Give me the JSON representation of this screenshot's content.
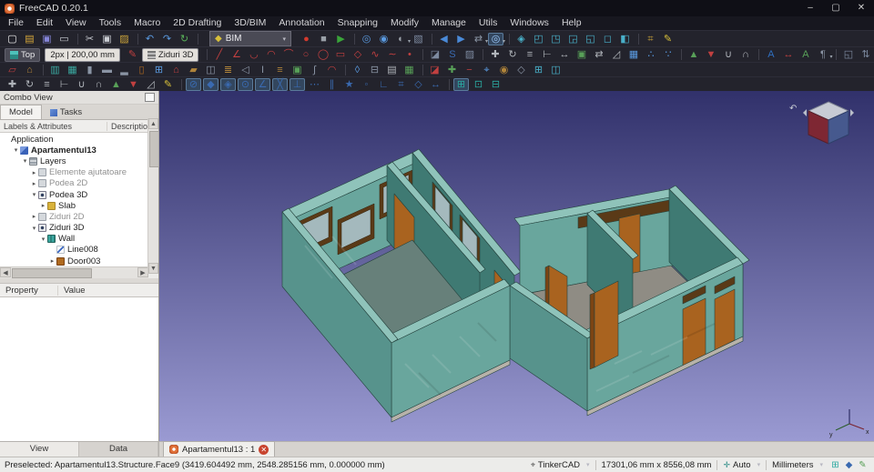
{
  "window": {
    "title": "FreeCAD 0.20.1",
    "minimize_glyph": "–",
    "maximize_glyph": "▢",
    "close_glyph": "✕"
  },
  "menu": {
    "items": [
      "File",
      "Edit",
      "View",
      "Tools",
      "Macro",
      "2D Drafting",
      "3D/BIM",
      "Annotation",
      "Snapping",
      "Modify",
      "Manage",
      "Utils",
      "Windows",
      "Help"
    ]
  },
  "toolbars": {
    "dropdown_glyph": "▾",
    "workbench": {
      "label": "BIM",
      "icon_glyph": "◆"
    },
    "working_plane_label": "Top",
    "line_width": "2px | 200,00 mm",
    "layer_label": "Ziduri 3D",
    "row1a": [
      {
        "n": "new-file-button",
        "g": "▢",
        "c": "#f0f0f0"
      },
      {
        "n": "open-file-button",
        "g": "▤",
        "c": "#d8a93a"
      },
      {
        "n": "save-button",
        "g": "▣",
        "c": "#8585d8"
      },
      {
        "n": "print-button",
        "g": "▭",
        "c": "#c9ccd2"
      },
      {
        "sep": true
      },
      {
        "n": "cut-button",
        "g": "✂",
        "c": "#c9ccd2"
      },
      {
        "n": "copy-button",
        "g": "▣",
        "c": "#c9ccd2"
      },
      {
        "n": "paste-button",
        "g": "▨",
        "c": "#c9a23a"
      },
      {
        "sep": true
      },
      {
        "n": "undo-button",
        "g": "↶",
        "c": "#5a9ae0"
      },
      {
        "n": "redo-button",
        "g": "↷",
        "c": "#5a9ae0"
      },
      {
        "n": "refresh-button",
        "g": "↻",
        "c": "#58b058"
      },
      {
        "sep": true
      }
    ],
    "row1b": [
      {
        "n": "macro-record-button",
        "g": "●",
        "c": "#d23a2e"
      },
      {
        "n": "macro-stop-button",
        "g": "■",
        "c": "#9aa0a8"
      },
      {
        "n": "macro-execute-button",
        "g": "▶",
        "c": "#3aa43a"
      },
      {
        "sep": true
      },
      {
        "n": "fit-all-button",
        "g": "◎",
        "c": "#5a9ae0"
      },
      {
        "n": "fit-selection-button",
        "g": "◉",
        "c": "#5a9ae0"
      },
      {
        "n": "draw-style-button",
        "g": "◐",
        "c": "#9aa0a8",
        "dd": 1
      },
      {
        "n": "appearance-button",
        "g": "▧",
        "c": "#7d8aa0"
      },
      {
        "sep": true
      },
      {
        "n": "nav-back-button",
        "g": "◀",
        "c": "#4a8ad8"
      },
      {
        "n": "nav-forward-button",
        "g": "▶",
        "c": "#4a8ad8"
      },
      {
        "n": "link-select-button",
        "g": "⇄",
        "c": "#8a94a4",
        "dd": 1
      },
      {
        "n": "zoom-tools-button",
        "g": "◎",
        "c": "#9ecbff",
        "dd": 1,
        "hl": 1
      },
      {
        "sep": true
      },
      {
        "n": "view-isometric-button",
        "g": "◈",
        "c": "#49b0c9"
      },
      {
        "n": "view-front-button",
        "g": "◰",
        "c": "#49b0c9"
      },
      {
        "n": "view-top-button",
        "g": "◳",
        "c": "#49b0c9"
      },
      {
        "n": "view-right-button",
        "g": "◲",
        "c": "#49b0c9"
      },
      {
        "n": "view-rear-button",
        "g": "◱",
        "c": "#49b0c9"
      },
      {
        "n": "view-bottom-button",
        "g": "◻",
        "c": "#49b0c9"
      },
      {
        "n": "view-left-button",
        "g": "◧",
        "c": "#49b0c9"
      },
      {
        "sep": true
      },
      {
        "n": "measure-button",
        "g": "⌗",
        "c": "#c9a23a"
      },
      {
        "n": "edit-mode-button",
        "g": "✎",
        "c": "#d8c03a"
      }
    ],
    "row2pre": [
      {
        "n": "draft-autogroup-pencil-icon",
        "g": "✎",
        "c": "#c24040"
      }
    ],
    "row2": [
      {
        "n": "draft-line-button",
        "g": "╱",
        "c": "#c24040"
      },
      {
        "n": "draft-polyline-button",
        "g": "∠",
        "c": "#c24040"
      },
      {
        "n": "draft-fillet-button",
        "g": "◡",
        "c": "#c24040"
      },
      {
        "n": "draft-arc-button",
        "g": "◠",
        "c": "#c24040"
      },
      {
        "n": "draft-arc-3points-button",
        "g": "⌒",
        "c": "#c24040"
      },
      {
        "n": "draft-circle-button",
        "g": "○",
        "c": "#c24040"
      },
      {
        "n": "draft-ellipse-button",
        "g": "◯",
        "c": "#c24040"
      },
      {
        "n": "draft-rectangle-button",
        "g": "▭",
        "c": "#c24040"
      },
      {
        "n": "draft-polygon-button",
        "g": "◇",
        "c": "#c24040"
      },
      {
        "n": "draft-bspline-button",
        "g": "∿",
        "c": "#c24040"
      },
      {
        "n": "draft-bezier-button",
        "g": "∼",
        "c": "#c24040"
      },
      {
        "n": "draft-point-button",
        "g": "•",
        "c": "#c24040"
      },
      {
        "sep": true
      },
      {
        "n": "draft-facebinder-button",
        "g": "◪",
        "c": "#7d8aa0"
      },
      {
        "n": "draft-shapestring-button",
        "g": "S",
        "c": "#3a6ab0"
      },
      {
        "n": "draft-hatch-button",
        "g": "▨",
        "c": "#7d8aa0"
      },
      {
        "sep": true
      },
      {
        "n": "draft-move-button",
        "g": "✚",
        "c": "#b0b4ba"
      },
      {
        "n": "draft-rotate-button",
        "g": "↻",
        "c": "#b0b4ba"
      },
      {
        "n": "draft-offset-button",
        "g": "≡",
        "c": "#b0b4ba"
      },
      {
        "n": "draft-trimex-button",
        "g": "⊢",
        "c": "#b0b4ba"
      },
      {
        "n": "draft-stretch-button",
        "g": "↔",
        "c": "#b0b4ba"
      },
      {
        "n": "draft-clone-button",
        "g": "▣",
        "c": "#58a058"
      },
      {
        "n": "draft-mirror-button",
        "g": "⇄",
        "c": "#b0b4ba"
      },
      {
        "n": "draft-scale-button",
        "g": "◿",
        "c": "#b0b4ba"
      },
      {
        "n": "draft-array-button",
        "g": "▦",
        "c": "#5a9ae0"
      },
      {
        "n": "draft-path-array-button",
        "g": "∴",
        "c": "#5a9ae0"
      },
      {
        "n": "draft-point-array-button",
        "g": "∵",
        "c": "#5a9ae0"
      },
      {
        "sep": true
      },
      {
        "n": "draft-upgrade-button",
        "g": "▲",
        "c": "#58a058"
      },
      {
        "n": "draft-downgrade-button",
        "g": "▼",
        "c": "#c24040"
      },
      {
        "n": "draft-join-button",
        "g": "∪",
        "c": "#b0b4ba"
      },
      {
        "n": "draft-split-button",
        "g": "∩",
        "c": "#b0b4ba"
      },
      {
        "sep": true
      },
      {
        "n": "annotation-text-button",
        "g": "A",
        "c": "#2f6fc0"
      },
      {
        "n": "annotation-dimension-button",
        "g": "↔",
        "c": "#c24040"
      },
      {
        "n": "annotation-label-button",
        "g": "A",
        "c": "#58a058"
      },
      {
        "n": "annotation-styles-button",
        "g": "¶",
        "c": "#8a94a4",
        "dd": 1
      },
      {
        "sep": true
      },
      {
        "n": "shape-2d-view-button",
        "g": "◱",
        "c": "#7d8aa0"
      },
      {
        "n": "draft-to-sketch-button",
        "g": "⇅",
        "c": "#7d8aa0"
      },
      {
        "n": "working-plane-proxy-button",
        "g": "⊞",
        "c": "#2aa8a0"
      },
      {
        "n": "draft-heal-button",
        "g": "✚",
        "c": "#c24040"
      }
    ],
    "row3": [
      {
        "n": "sketch-button",
        "g": "▱",
        "c": "#c24040"
      },
      {
        "n": "bim-project-button",
        "g": "⌂",
        "c": "#b0843a"
      },
      {
        "sep": true
      },
      {
        "n": "arch-wall-button",
        "g": "▥",
        "c": "#3aa8a0"
      },
      {
        "n": "arch-curtain-wall-button",
        "g": "▦",
        "c": "#3aa8a0"
      },
      {
        "n": "arch-column-button",
        "g": "▮",
        "c": "#8a94a4"
      },
      {
        "n": "arch-beam-button",
        "g": "▬",
        "c": "#8a94a4"
      },
      {
        "n": "arch-slab-button",
        "g": "▂",
        "c": "#8a94a4"
      },
      {
        "n": "arch-door-button",
        "g": "▯",
        "c": "#b06a1f"
      },
      {
        "n": "arch-window-button",
        "g": "⊞",
        "c": "#5a9ae0"
      },
      {
        "n": "arch-roof-button",
        "g": "⌂",
        "c": "#c24040"
      },
      {
        "n": "arch-panel-button",
        "g": "▰",
        "c": "#b0843a"
      },
      {
        "n": "arch-frame-button",
        "g": "◫",
        "c": "#8a94a4"
      },
      {
        "n": "arch-fence-button",
        "g": "≣",
        "c": "#b0843a"
      },
      {
        "n": "arch-truss-button",
        "g": "◁",
        "c": "#8a94a4"
      },
      {
        "n": "arch-profile-button",
        "g": "I",
        "c": "#8a94a4"
      },
      {
        "n": "arch-stairs-button",
        "g": "≡",
        "c": "#b0843a"
      },
      {
        "n": "arch-equipment-button",
        "g": "▣",
        "c": "#58a058"
      },
      {
        "n": "arch-pipe-button",
        "g": "∫",
        "c": "#8a94a4"
      },
      {
        "n": "arch-rebar-button",
        "g": "◠",
        "c": "#c24040"
      },
      {
        "sep": true
      },
      {
        "n": "arch-space-button",
        "g": "◊",
        "c": "#5a9ae0"
      },
      {
        "n": "arch-section-plane-button",
        "g": "⊟",
        "c": "#8a94a4"
      },
      {
        "n": "bim-drawing-button",
        "g": "▤",
        "c": "#b0b4ba"
      },
      {
        "n": "bim-schedule-button",
        "g": "▦",
        "c": "#58a058"
      },
      {
        "sep": true
      },
      {
        "n": "arch-cut-plane-button",
        "g": "◪",
        "c": "#c24040"
      },
      {
        "n": "arch-add-button",
        "g": "✚",
        "c": "#58a058"
      },
      {
        "n": "arch-remove-button",
        "g": "−",
        "c": "#c24040"
      },
      {
        "n": "arch-survey-button",
        "g": "⌖",
        "c": "#5a9ae0"
      },
      {
        "n": "bim-material-button",
        "g": "◉",
        "c": "#b0843a"
      },
      {
        "n": "bim-ifc-button",
        "g": "◇",
        "c": "#8a94a4"
      },
      {
        "n": "bim-views-button",
        "g": "⊞",
        "c": "#49b0c9"
      },
      {
        "n": "bim-windows-button",
        "g": "◫",
        "c": "#49b0c9"
      }
    ],
    "row4": [
      {
        "n": "modify-move-button",
        "g": "✚",
        "c": "#b0b4ba"
      },
      {
        "n": "modify-rotate-button",
        "g": "↻",
        "c": "#b0b4ba"
      },
      {
        "n": "modify-offset-button",
        "g": "≡",
        "c": "#b0b4ba"
      },
      {
        "n": "modify-trimex-button",
        "g": "⊢",
        "c": "#b0b4ba"
      },
      {
        "n": "modify-join-button",
        "g": "∪",
        "c": "#b0b4ba"
      },
      {
        "n": "modify-split-button",
        "g": "∩",
        "c": "#b0b4ba"
      },
      {
        "n": "modify-upgrade-button",
        "g": "▲",
        "c": "#58a058"
      },
      {
        "n": "modify-downgrade-button",
        "g": "▼",
        "c": "#c24040"
      },
      {
        "n": "modify-scale-button",
        "g": "◿",
        "c": "#b0b4ba"
      },
      {
        "n": "modify-edit-button",
        "g": "✎",
        "c": "#d8c03a"
      },
      {
        "sep": true
      },
      {
        "n": "snap-lock-button",
        "g": "⊘",
        "c": "#3a6ab0",
        "hl": 1
      },
      {
        "n": "snap-endpoint-button",
        "g": "◆",
        "c": "#3a6ab0",
        "hl": 1
      },
      {
        "n": "snap-midpoint-button",
        "g": "◈",
        "c": "#3a6ab0",
        "hl": 1
      },
      {
        "n": "snap-center-button",
        "g": "⊙",
        "c": "#3a6ab0",
        "hl": 1
      },
      {
        "n": "snap-angle-button",
        "g": "∠",
        "c": "#3a6ab0",
        "hl": 1
      },
      {
        "n": "snap-intersection-button",
        "g": "╳",
        "c": "#3a6ab0",
        "hl": 1
      },
      {
        "n": "snap-perpendicular-button",
        "g": "⊥",
        "c": "#3a6ab0",
        "hl": 1
      },
      {
        "n": "snap-extension-button",
        "g": "⋯",
        "c": "#3a6ab0"
      },
      {
        "n": "snap-parallel-button",
        "g": "∥",
        "c": "#3a6ab0"
      },
      {
        "n": "snap-special-button",
        "g": "★",
        "c": "#3a6ab0"
      },
      {
        "n": "snap-near-button",
        "g": "◦",
        "c": "#3a6ab0"
      },
      {
        "n": "snap-ortho-button",
        "g": "∟",
        "c": "#3a6ab0"
      },
      {
        "n": "snap-grid-button",
        "g": "⌗",
        "c": "#3a6ab0"
      },
      {
        "n": "snap-working-plane-button",
        "g": "◇",
        "c": "#3a6ab0"
      },
      {
        "n": "snap-dimensions-button",
        "g": "↔",
        "c": "#3a6ab0"
      },
      {
        "sep": true
      },
      {
        "n": "toggle-grid-button",
        "g": "⊞",
        "c": "#2aa8a0",
        "hl": 1
      },
      {
        "n": "working-plane-view-button",
        "g": "⊡",
        "c": "#2aa8a0"
      },
      {
        "n": "working-plane-front-button",
        "g": "⊟",
        "c": "#2aa8a0"
      }
    ]
  },
  "combo_view": {
    "title": "Combo View",
    "tabs": [
      "Model",
      "Tasks"
    ],
    "tree_headers": [
      "Labels & Attributes",
      "Description"
    ],
    "tree": [
      {
        "label": "Application",
        "indent": 0,
        "exp": "",
        "icon": ""
      },
      {
        "label": "Apartamentul13",
        "indent": 1,
        "exp": "open",
        "icon": "document",
        "bold": true
      },
      {
        "label": "Layers",
        "indent": 2,
        "exp": "open",
        "icon": "layers"
      },
      {
        "label": "Elemente ajutatoare",
        "indent": 3,
        "exp": "closed",
        "icon": "layer",
        "muted": true
      },
      {
        "label": "Podea 2D",
        "indent": 3,
        "exp": "closed",
        "icon": "layer",
        "muted": true
      },
      {
        "label": "Podea 3D",
        "indent": 3,
        "exp": "open",
        "icon": "layer-on"
      },
      {
        "label": "Slab",
        "indent": 4,
        "exp": "closed",
        "icon": "slab"
      },
      {
        "label": "Ziduri 2D",
        "indent": 3,
        "exp": "closed",
        "icon": "layer",
        "muted": true
      },
      {
        "label": "Ziduri 3D",
        "indent": 3,
        "exp": "open",
        "icon": "layer-on"
      },
      {
        "label": "Wall",
        "indent": 4,
        "exp": "open",
        "icon": "wall"
      },
      {
        "label": "Line008",
        "indent": 5,
        "exp": "none",
        "icon": "line"
      },
      {
        "label": "Door003",
        "indent": 5,
        "exp": "closed",
        "icon": "door"
      }
    ],
    "property_headers": [
      "Property",
      "Value"
    ],
    "bottom_tabs": [
      "View",
      "Data"
    ]
  },
  "document_tab": {
    "label": "Apartamentul13 : 1",
    "close_glyph": "✕"
  },
  "viewport": {
    "axis_x": "x",
    "axis_y": "y"
  },
  "statusbar": {
    "message": "Preselected: Apartamentul13.Structure.Face9 (3419.604492 mm, 2548.285156 mm, 0.000000 mm)",
    "nav_icon_glyph": "⌖",
    "nav_style": "TinkerCAD",
    "dimensions": "17301,06 mm x 8556,08 mm",
    "plane_icon_glyph": "✛",
    "plane_mode": "Auto",
    "units": "Millimeters",
    "icons": [
      {
        "n": "status-grid-icon",
        "g": "⊞",
        "c": "#2aa8a0"
      },
      {
        "n": "status-snap-icon",
        "g": "◆",
        "c": "#3a6ab0"
      },
      {
        "n": "status-edit-icon",
        "g": "✎",
        "c": "#58a058"
      }
    ]
  },
  "colors": {
    "viewport_top": "#31316b",
    "viewport_bottom": "#9a9ad2",
    "wall_top": "#8fc3ba",
    "wall_lit": "#69a69d",
    "wall_mid": "#57938c",
    "wall_dark": "#3f7a73",
    "door": "#a9631f",
    "door_dark": "#7c4413",
    "window_frame": "#5a3a17",
    "window_glass": "#a4b9bd",
    "floor": "#8f8c84",
    "floor_dim": "#67807a",
    "base": "#b7b2a9"
  }
}
